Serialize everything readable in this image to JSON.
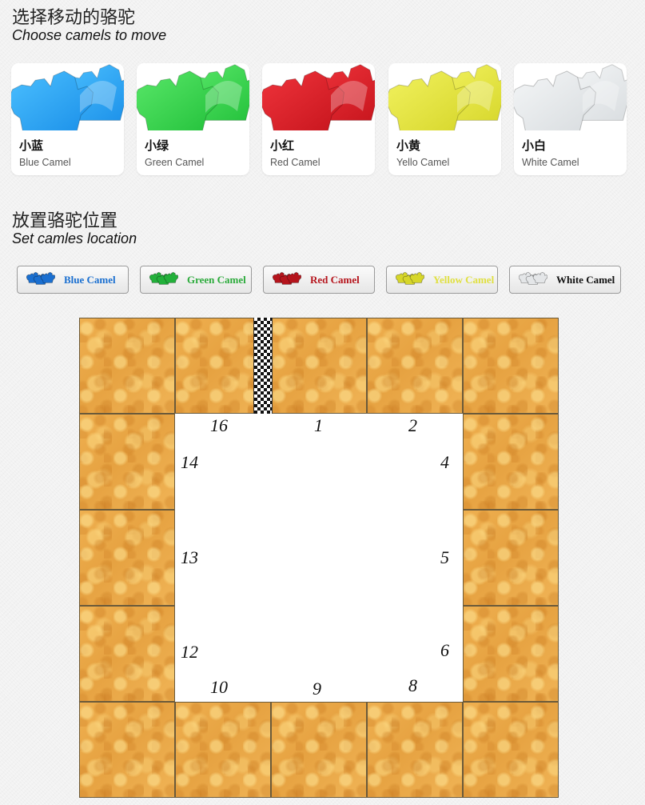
{
  "choose": {
    "title_cn": "选择移动的骆驼",
    "title_en": "Choose camels to move"
  },
  "camels": [
    {
      "name_cn": "小蓝",
      "name_en": "Blue Camel",
      "color": "#1a8fe8",
      "light": "#4cc0ff",
      "icon": "blue-camel-icon"
    },
    {
      "name_cn": "小绿",
      "name_en": "Green Camel",
      "color": "#22c03a",
      "light": "#5ae86a",
      "icon": "green-camel-icon"
    },
    {
      "name_cn": "小红",
      "name_en": "Red Camel",
      "color": "#c5141c",
      "light": "#f0343c",
      "icon": "red-camel-icon"
    },
    {
      "name_cn": "小黄",
      "name_en": "Yello Camel",
      "color": "#d6d62a",
      "light": "#f2f260",
      "icon": "yellow-camel-icon"
    },
    {
      "name_cn": "小白",
      "name_en": "White Camel",
      "color": "#d8dcdf",
      "light": "#f4f6f7",
      "icon": "white-camel-icon"
    }
  ],
  "location": {
    "title_cn": "放置骆驼位置",
    "title_en": "Set camles location",
    "buttons": [
      {
        "label": "Blue Camel",
        "color": "#1a6fd0",
        "text_color": "#1a6fd0"
      },
      {
        "label": "Green Camel",
        "color": "#22b03a",
        "text_color": "#2aaa3a"
      },
      {
        "label": "Red Camel",
        "color": "#b5141c",
        "text_color": "#b5141c"
      },
      {
        "label": "Yellow Camel",
        "color": "#d6d62a",
        "text_color": "#e0e040"
      },
      {
        "label": "White Camel",
        "color": "#e4e6e8",
        "text_color": "#111111"
      }
    ]
  },
  "board": {
    "position_numbers": [
      "16",
      "1",
      "2",
      "14",
      "4",
      "13",
      "5",
      "12",
      "6",
      "10",
      "9",
      "8"
    ]
  }
}
